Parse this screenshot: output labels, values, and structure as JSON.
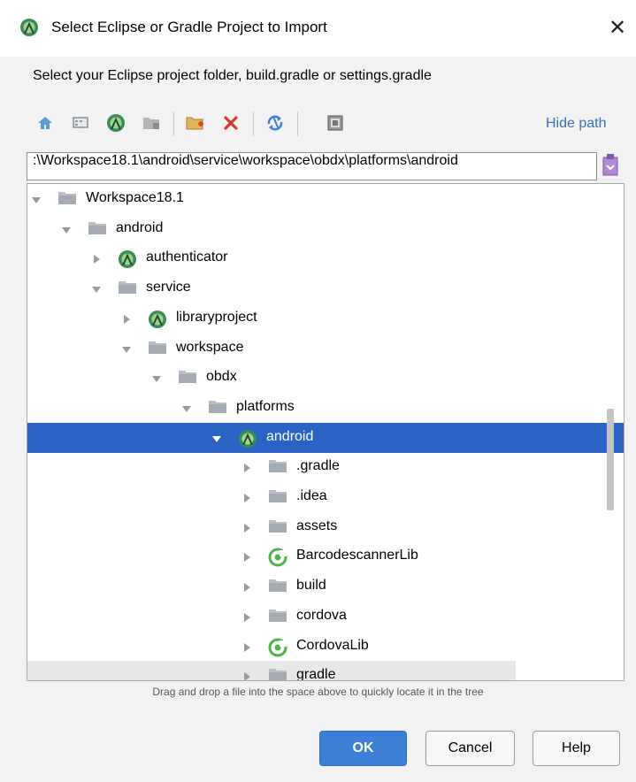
{
  "window": {
    "title": "Select Eclipse or Gradle Project to Import",
    "close_glyph": "✕"
  },
  "subtitle": "Select your Eclipse project folder, build.gradle or settings.gradle",
  "toolbar": {
    "icons": [
      "home-icon",
      "desktop-icon",
      "android-project-icon",
      "module-folder-icon",
      "new-folder-icon",
      "delete-icon",
      "refresh-icon",
      "show-hidden-icon"
    ],
    "hide_path_label": "Hide path"
  },
  "path": {
    "value": ":\\Workspace18.1\\android\\service\\workspace\\obdx\\platforms\\android"
  },
  "tree": {
    "items": [
      {
        "label": "Workspace18.1",
        "icon": "folder-icon",
        "expanded": true
      },
      {
        "label": "android",
        "icon": "folder-icon",
        "expanded": true
      },
      {
        "label": "authenticator",
        "icon": "android-module-icon",
        "expanded": false
      },
      {
        "label": "service",
        "icon": "folder-icon",
        "expanded": true
      },
      {
        "label": "libraryproject",
        "icon": "android-module-icon",
        "expanded": false
      },
      {
        "label": "workspace",
        "icon": "folder-icon",
        "expanded": true
      },
      {
        "label": "obdx",
        "icon": "folder-icon",
        "expanded": true
      },
      {
        "label": "platforms",
        "icon": "folder-icon",
        "expanded": true
      },
      {
        "label": "android",
        "icon": "android-module-icon",
        "expanded": true,
        "selected": true
      },
      {
        "label": ".gradle",
        "icon": "folder-icon",
        "expanded": false
      },
      {
        "label": ".idea",
        "icon": "folder-icon",
        "expanded": false
      },
      {
        "label": "assets",
        "icon": "folder-icon",
        "expanded": false
      },
      {
        "label": "BarcodescannerLib",
        "icon": "gradle-module-icon",
        "expanded": false
      },
      {
        "label": "build",
        "icon": "folder-icon",
        "expanded": false
      },
      {
        "label": "cordova",
        "icon": "folder-icon",
        "expanded": false
      },
      {
        "label": "CordovaLib",
        "icon": "gradle-module-icon",
        "expanded": false
      },
      {
        "label": "gradle",
        "icon": "folder-icon",
        "expanded": false
      }
    ]
  },
  "hint": "Drag and drop a file into the space above to quickly locate it in the tree",
  "buttons": {
    "ok": "OK",
    "cancel": "Cancel",
    "help": "Help"
  },
  "colors": {
    "selection": "#2b63c4",
    "link": "#3a6fb5",
    "ok_button": "#3d7fd6",
    "android_green": "#78c257"
  }
}
